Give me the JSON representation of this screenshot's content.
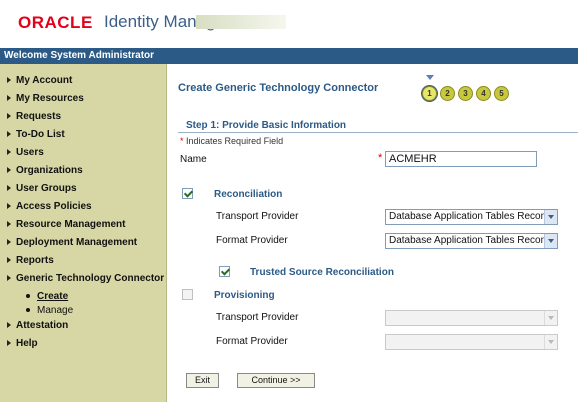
{
  "header": {
    "brand": "ORACLE",
    "product": "Identity Manager"
  },
  "welcome": "Welcome System Administrator",
  "sidebar": {
    "items": [
      {
        "label": "My Account"
      },
      {
        "label": "My Resources"
      },
      {
        "label": "Requests"
      },
      {
        "label": "To-Do List"
      },
      {
        "label": "Users"
      },
      {
        "label": "Organizations"
      },
      {
        "label": "User Groups"
      },
      {
        "label": "Access Policies"
      },
      {
        "label": "Resource Management"
      },
      {
        "label": "Deployment Management"
      },
      {
        "label": "Reports"
      },
      {
        "label": "Generic Technology Connector"
      },
      {
        "label": "Attestation"
      },
      {
        "label": "Help"
      }
    ],
    "subitems": [
      {
        "label": "Create",
        "active": true
      },
      {
        "label": "Manage",
        "active": false
      }
    ]
  },
  "main": {
    "title": "Create Generic Technology Connector",
    "steps": [
      "1",
      "2",
      "3",
      "4",
      "5"
    ],
    "current_step": 1,
    "step_title": "Step 1: Provide Basic Information",
    "required_note": "Indicates Required Field",
    "name_label": "Name",
    "name_value": "ACMEHR",
    "reconciliation": {
      "label": "Reconciliation",
      "checked": true,
      "transport_label": "Transport Provider",
      "transport_value": "Database Application Tables Recon",
      "format_label": "Format Provider",
      "format_value": "Database Application Tables Recon",
      "trusted_label": "Trusted Source Reconciliation",
      "trusted_checked": true
    },
    "provisioning": {
      "label": "Provisioning",
      "checked": false,
      "transport_label": "Transport Provider",
      "transport_value": "",
      "format_label": "Format Provider",
      "format_value": ""
    },
    "buttons": {
      "exit": "Exit",
      "continue": "Continue >>"
    }
  }
}
